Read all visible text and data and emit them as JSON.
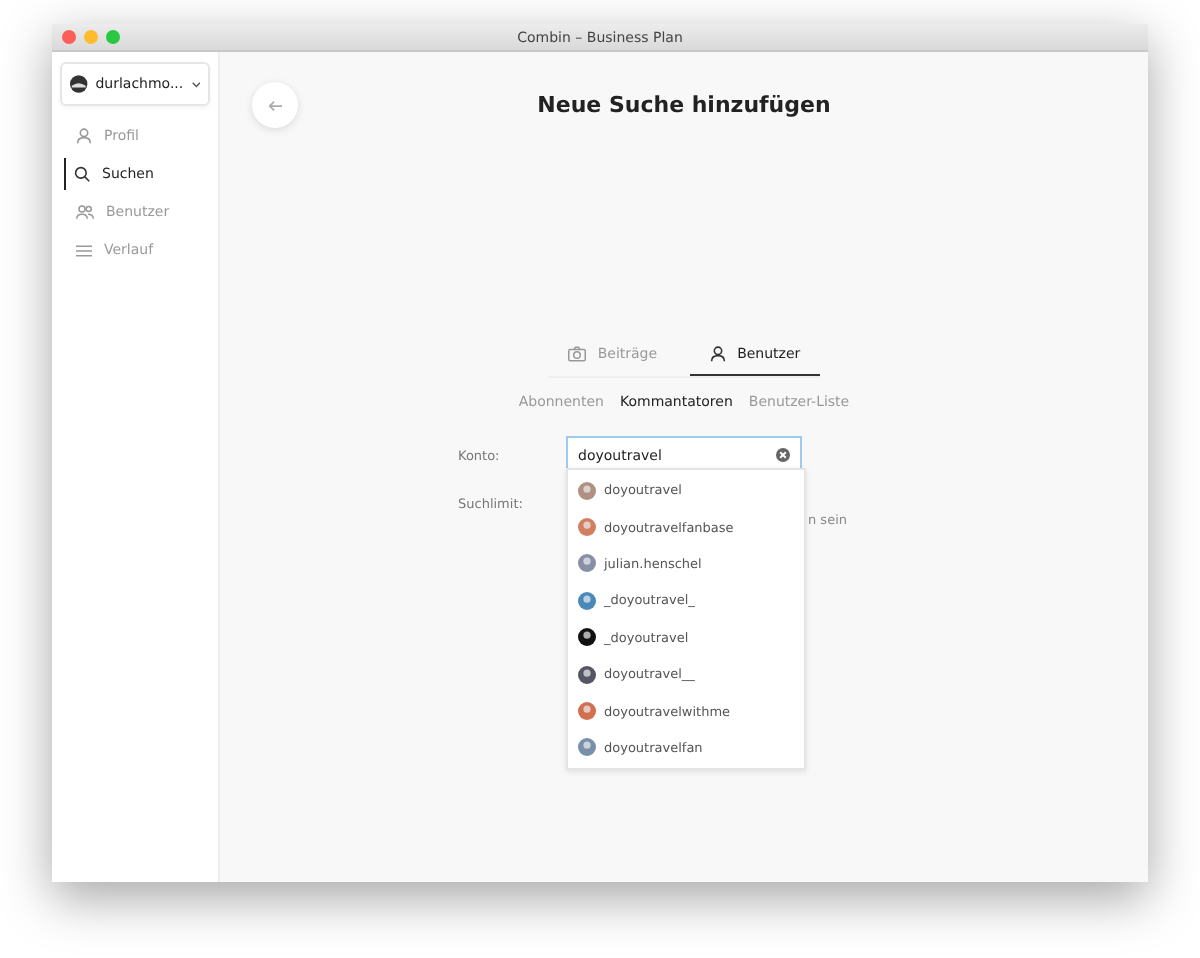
{
  "window": {
    "title": "Combin – Business Plan"
  },
  "account": {
    "name": "durlachmo..."
  },
  "sidebar": {
    "items": [
      {
        "label": "Profil",
        "selected": false,
        "kind": "profile"
      },
      {
        "label": "Suchen",
        "selected": true,
        "kind": "search"
      },
      {
        "label": "Benutzer",
        "selected": false,
        "kind": "users"
      },
      {
        "label": "Verlauf",
        "selected": false,
        "kind": "history"
      }
    ]
  },
  "page": {
    "title": "Neue Suche hinzufügen"
  },
  "tabs": [
    {
      "label": "Beiträge",
      "selected": false,
      "kind": "camera"
    },
    {
      "label": "Benutzer",
      "selected": true,
      "kind": "user"
    }
  ],
  "subtabs": [
    {
      "label": "Abonnenten",
      "selected": false
    },
    {
      "label": "Kommantatoren",
      "selected": true
    },
    {
      "label": "Benutzer-Liste",
      "selected": false
    }
  ],
  "form": {
    "account_label": "Konto:",
    "account_value": "doyoutravel",
    "limit_label": "Suchlimit:",
    "hint_fragment": "n sein"
  },
  "suggestions": [
    {
      "name": "doyoutravel"
    },
    {
      "name": "doyoutravelfanbase"
    },
    {
      "name": "julian.henschel"
    },
    {
      "name": "_doyoutravel_"
    },
    {
      "name": "_doyoutravel"
    },
    {
      "name": "doyoutravel__"
    },
    {
      "name": "doyoutravelwithme"
    },
    {
      "name": "doyoutravelfan"
    }
  ]
}
